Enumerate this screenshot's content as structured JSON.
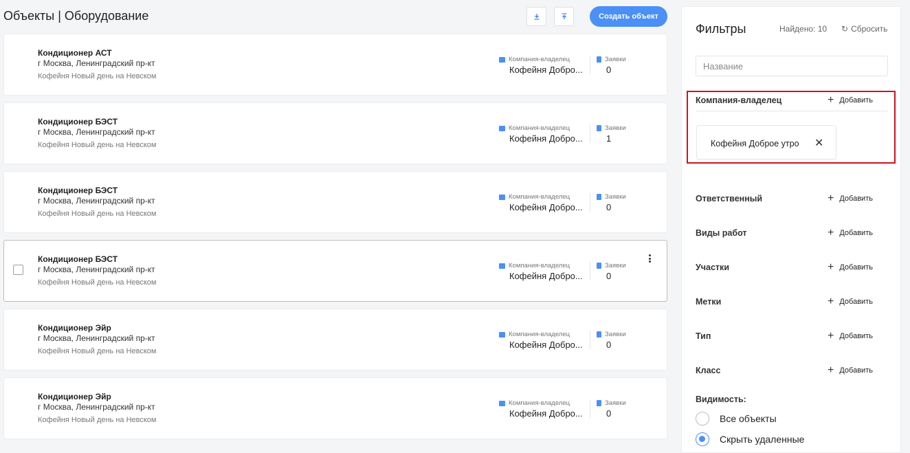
{
  "header": {
    "title": "Объекты | Оборудование",
    "download_icon": "download-icon",
    "upload_icon": "upload-icon",
    "create_label": "Создать объект"
  },
  "cards": [
    {
      "title": "Кондиционер АСТ",
      "address": "г Москва, Ленинградский пр-кт",
      "company": "Кофейня Новый день на Невском",
      "owner_label": "Компания-владелец",
      "owner_value": "Кофейня Добро...",
      "req_label": "Заявки",
      "req_value": "0"
    },
    {
      "title": "Кондиционер БЭСТ",
      "address": "г Москва, Ленинградский пр-кт",
      "company": "Кофейня Новый день на Невском",
      "owner_label": "Компания-владелец",
      "owner_value": "Кофейня Добро...",
      "req_label": "Заявки",
      "req_value": "1"
    },
    {
      "title": "Кондиционер БЭСТ",
      "address": "г Москва, Ленинградский пр-кт",
      "company": "Кофейня Новый день на Невском",
      "owner_label": "Компания-владелец",
      "owner_value": "Кофейня Добро...",
      "req_label": "Заявки",
      "req_value": "0"
    },
    {
      "title": "Кондиционер БЭСТ",
      "address": "г Москва, Ленинградский пр-кт",
      "company": "Кофейня Новый день на Невском",
      "owner_label": "Компания-владелец",
      "owner_value": "Кофейня Добро...",
      "req_label": "Заявки",
      "req_value": "0"
    },
    {
      "title": "Кондиционер Эйр",
      "address": "г Москва, Ленинградский пр-кт",
      "company": "Кофейня Новый день на Невском",
      "owner_label": "Компания-владелец",
      "owner_value": "Кофейня Добро...",
      "req_label": "Заявки",
      "req_value": "0"
    },
    {
      "title": "Кондиционер Эйр",
      "address": "г Москва, Ленинградский пр-кт",
      "company": "Кофейня Новый день на Невском",
      "owner_label": "Компания-владелец",
      "owner_value": "Кофейня Добро...",
      "req_label": "Заявки",
      "req_value": "0"
    }
  ],
  "filters": {
    "title": "Фильтры",
    "found": "Найдено: 10",
    "reset": "Сбросить",
    "search_placeholder": "Название",
    "add_label": "Добавить",
    "sections": {
      "owner": "Компания-владелец",
      "responsible": "Ответственный",
      "work_types": "Виды работ",
      "sites": "Участки",
      "tags": "Метки",
      "type": "Тип",
      "class": "Класс"
    },
    "selected_chip": "Кофейня Доброе утро",
    "visibility_label": "Видимость:",
    "visibility_options": [
      "Все объекты",
      "Скрыть удаленные"
    ],
    "visibility_selected": "Скрыть удаленные"
  },
  "colors": {
    "accent": "#4a90f7",
    "highlight": "#d0121b"
  }
}
